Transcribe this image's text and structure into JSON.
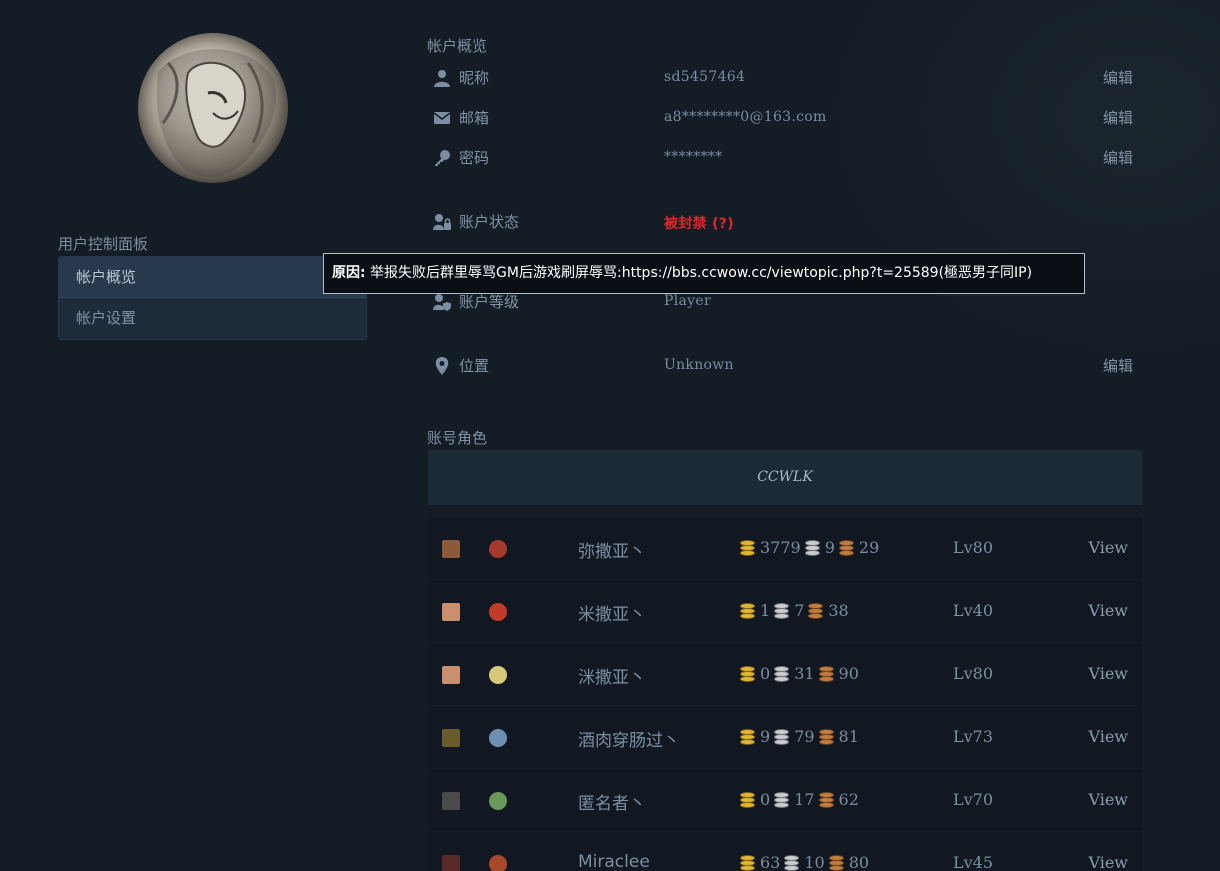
{
  "sidebar": {
    "panel_title": "用户控制面板",
    "items": [
      {
        "label": "帐户概览",
        "active": true
      },
      {
        "label": "帐户设置",
        "active": false
      }
    ]
  },
  "overview": {
    "title": "帐户概览",
    "nickname": {
      "label": "昵称",
      "value": "sd5457464",
      "edit": "编辑",
      "icon": "user-icon"
    },
    "email": {
      "label": "邮箱",
      "value": "a8********0@163.com",
      "edit": "编辑",
      "icon": "envelope-icon"
    },
    "password": {
      "label": "密码",
      "value": "********",
      "edit": "编辑",
      "icon": "key-icon"
    },
    "status": {
      "label": "账户状态",
      "value": "被封禁 (?)",
      "icon": "user-lock-icon",
      "color": "#e0262b"
    },
    "level": {
      "label": "账户等级",
      "value": "Player",
      "icon": "user-shield-icon"
    },
    "location": {
      "label": "位置",
      "value": "Unknown",
      "edit": "编辑",
      "icon": "map-pin-icon"
    }
  },
  "tooltip": {
    "reason_label": "原因:",
    "reason_text": " 举报失败后群里辱骂GM后游戏刷屏辱骂:https://bbs.ccwow.cc/viewtopic.php?t=25589(極恶男子同IP)"
  },
  "characters": {
    "title": "账号角色",
    "realm": "CCWLK",
    "list": [
      {
        "name": "弥撒亚丶",
        "gold": "3779",
        "silver": "9",
        "copper": "29",
        "level": "Lv80",
        "view": "View"
      },
      {
        "name": "米撒亚丶",
        "gold": "1",
        "silver": "7",
        "copper": "38",
        "level": "Lv40",
        "view": "View"
      },
      {
        "name": "洣撒亚丶",
        "gold": "0",
        "silver": "31",
        "copper": "90",
        "level": "Lv80",
        "view": "View"
      },
      {
        "name": "酒肉穿肠过丶",
        "gold": "9",
        "silver": "79",
        "copper": "81",
        "level": "Lv73",
        "view": "View"
      },
      {
        "name": "匿名者丶",
        "gold": "0",
        "silver": "17",
        "copper": "62",
        "level": "Lv70",
        "view": "View"
      },
      {
        "name": "Miraclee",
        "gold": "63",
        "silver": "10",
        "copper": "80",
        "level": "Lv45",
        "view": "View"
      }
    ]
  }
}
